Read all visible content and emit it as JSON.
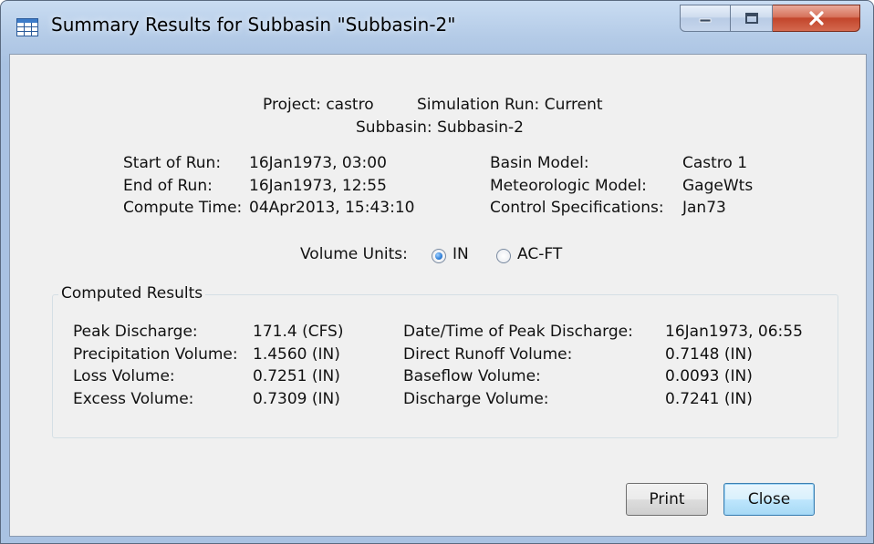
{
  "window": {
    "title": "Summary Results for Subbasin \"Subbasin-2\"",
    "icon": "table-icon"
  },
  "header": {
    "project_label": "Project:",
    "project_value": "castro",
    "simrun_label": "Simulation Run:",
    "simrun_value": "Current",
    "subbasin_label": "Subbasin:",
    "subbasin_value": "Subbasin-2"
  },
  "run_info": {
    "start_label": "Start of Run:",
    "start_value": "16Jan1973, 03:00",
    "end_label": "End of Run:",
    "end_value": "16Jan1973, 12:55",
    "compute_label": "Compute Time:",
    "compute_value": "04Apr2013, 15:43:10",
    "basin_label": "Basin Model:",
    "basin_value": "Castro 1",
    "met_label": "Meteorologic Model:",
    "met_value": "GageWts",
    "control_label": "Control Specifications:",
    "control_value": "Jan73"
  },
  "volume_units": {
    "label": "Volume Units:",
    "options": [
      "IN",
      "AC-FT"
    ],
    "selected": "IN"
  },
  "results": {
    "group_title": "Computed Results",
    "left": [
      {
        "label": "Peak Discharge:",
        "value": "171.4 (CFS)"
      },
      {
        "label": "Precipitation Volume:",
        "value": "1.4560 (IN)"
      },
      {
        "label": "Loss Volume:",
        "value": "0.7251 (IN)"
      },
      {
        "label": "Excess Volume:",
        "value": "0.7309 (IN)"
      }
    ],
    "right": [
      {
        "label": "Date/Time of Peak Discharge:",
        "value": "16Jan1973, 06:55"
      },
      {
        "label": "Direct Runoff Volume:",
        "value": "0.7148 (IN)"
      },
      {
        "label": "Baseflow Volume:",
        "value": "0.0093 (IN)"
      },
      {
        "label": "Discharge Volume:",
        "value": "0.7241 (IN)"
      }
    ]
  },
  "buttons": {
    "print": "Print",
    "close": "Close"
  },
  "colors": {
    "title_bar": "#b4cbe7",
    "close_button": "#c2452b",
    "dialog_bg": "#f0f0f0",
    "default_button": "#bee6fd"
  }
}
